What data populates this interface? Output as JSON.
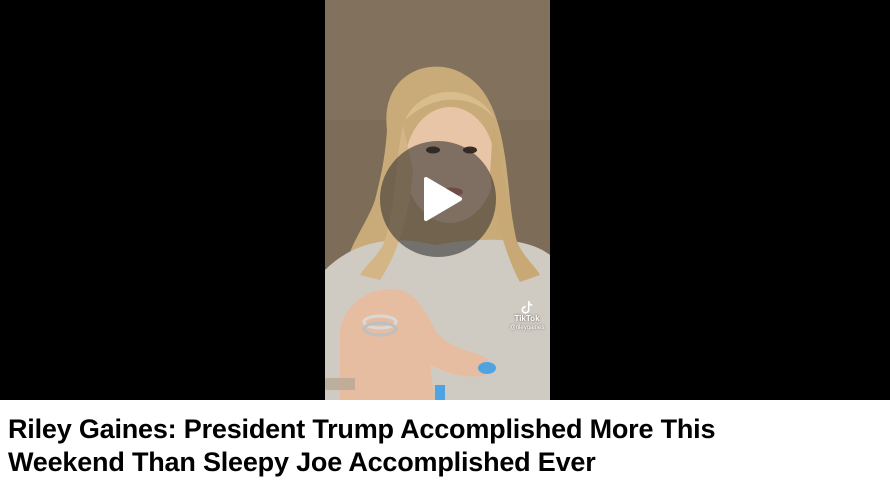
{
  "video": {
    "watermark_brand": "TikTok",
    "watermark_handle": "@rileygaines",
    "play_icon": "play-icon",
    "watermark_icon": "tiktok-icon"
  },
  "headline": {
    "line1": "Riley Gaines: President Trump Accomplished More This",
    "line2": "Weekend Than Sleepy Joe Accomplished Ever"
  },
  "colors": {
    "letterbox": "#000000",
    "headline_text": "#000000",
    "page_background": "#ffffff"
  }
}
